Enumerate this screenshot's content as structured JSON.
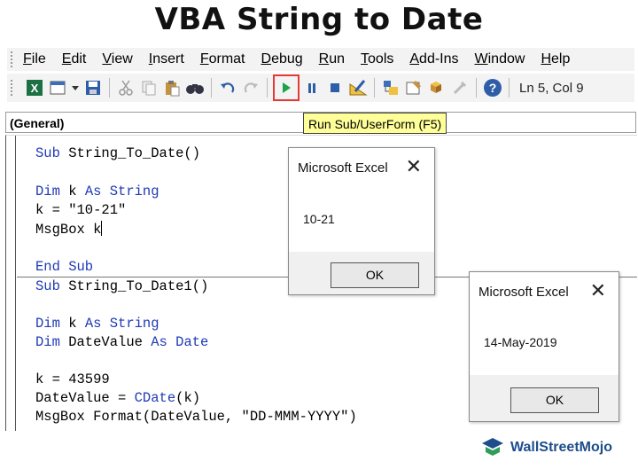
{
  "title": "VBA String to Date",
  "menu": [
    "File",
    "Edit",
    "View",
    "Insert",
    "Format",
    "Debug",
    "Run",
    "Tools",
    "Add-Ins",
    "Window",
    "Help"
  ],
  "toolbar": {
    "icons": [
      "excel-icon",
      "userform-icon",
      "dropdown-icon",
      "save-icon",
      "cut-icon",
      "copy-icon",
      "paste-icon",
      "find-icon",
      "undo-icon",
      "redo-icon",
      "run-icon",
      "pause-icon",
      "reset-icon",
      "design-mode-icon",
      "project-explorer-icon",
      "properties-icon",
      "object-browser-icon",
      "toolbox-icon",
      "help-icon"
    ],
    "status": "Ln 5, Col 9"
  },
  "combo": {
    "value": "(General)"
  },
  "tooltip": "Run Sub/UserForm (F5)",
  "code": {
    "sub1": {
      "sub_kw": "Sub",
      "sub_name": " String_To_Date()",
      "dim_kw": "Dim",
      "dim_mid": " k ",
      "as_kw": "As",
      "string_kw": " String",
      "assign": "k = \"10-21\"",
      "msgbox": "MsgBox k",
      "end": "End Sub"
    },
    "sub2": {
      "sub_kw": "Sub",
      "sub_name": " String_To_Date1()",
      "dim1_kw": "Dim",
      "dim1_mid": " k ",
      "as1_kw": "As",
      "string_kw": " String",
      "dim2_kw": "Dim",
      "dim2_mid": " DateValue ",
      "as2_kw": "As",
      "date_kw": " Date",
      "assign_k": "k = 43599",
      "assign_dv_pre": "DateValue = ",
      "cdate_kw": "CDate",
      "assign_dv_post": "(k)",
      "msgbox": "MsgBox Format(DateValue, \"DD-MMM-YYYY\")"
    }
  },
  "dialog1": {
    "title": "Microsoft Excel",
    "close": "✕",
    "message": "10-21",
    "ok": "OK"
  },
  "dialog2": {
    "title": "Microsoft Excel",
    "close": "✕",
    "message": "14-May-2019",
    "ok": "OK"
  },
  "branding": {
    "text": "WallStreetMojo"
  },
  "colors": {
    "keyword": "#1f3ab5",
    "tooltip_bg": "#ffff99",
    "run_highlight": "#e53935",
    "run_icon": "#1aa34a"
  }
}
